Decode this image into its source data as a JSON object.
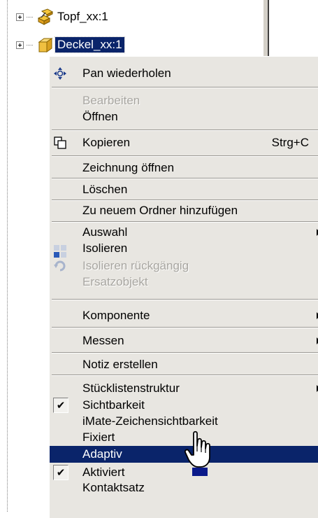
{
  "tree": {
    "nodes": [
      {
        "label": "Topf_xx:1",
        "icon": "assembly-icon"
      },
      {
        "label": "Deckel_xx:1",
        "icon": "part-icon",
        "selected": true
      }
    ]
  },
  "menu": {
    "pan": {
      "label": "Pan wiederholen",
      "icon": "pan-icon"
    },
    "bearbeiten": {
      "label": "Bearbeiten",
      "disabled": true
    },
    "oeffnen": {
      "label": "Öffnen"
    },
    "kopieren": {
      "label": "Kopieren",
      "shortcut": "Strg+C",
      "icon": "copy-icon"
    },
    "zeichnung": {
      "label": "Zeichnung öffnen"
    },
    "loeschen": {
      "label": "Löschen"
    },
    "ordner": {
      "label": "Zu neuem Ordner hinzufügen"
    },
    "auswahl": {
      "label": "Auswahl",
      "submenu": true
    },
    "isolieren": {
      "label": "Isolieren",
      "icon": "isolate-icon"
    },
    "isolieren_undo": {
      "label": "Isolieren rückgängig",
      "disabled": true,
      "icon": "undo-isolate-icon"
    },
    "ersatz": {
      "label": "Ersatzobjekt",
      "disabled": true
    },
    "komponente": {
      "label": "Komponente",
      "submenu": true
    },
    "messen": {
      "label": "Messen",
      "submenu": true
    },
    "notiz": {
      "label": "Notiz erstellen"
    },
    "stueckliste": {
      "label": "Stücklistenstruktur",
      "submenu": true
    },
    "sichtbarkeit": {
      "label": "Sichtbarkeit",
      "checked": true
    },
    "imate": {
      "label": "iMate-Zeichensichtbarkeit"
    },
    "fixiert": {
      "label": "Fixiert"
    },
    "adaptiv": {
      "label": "Adaptiv",
      "highlighted": true
    },
    "aktiviert": {
      "label": "Aktiviert",
      "checked": true
    },
    "kontaktsatz": {
      "label": "Kontaktsatz"
    }
  },
  "check_glyph": "✔",
  "colors": {
    "highlight": "#0a246a",
    "menu_bg": "#e8e6e1",
    "disabled_text": "#a8a6a1"
  }
}
